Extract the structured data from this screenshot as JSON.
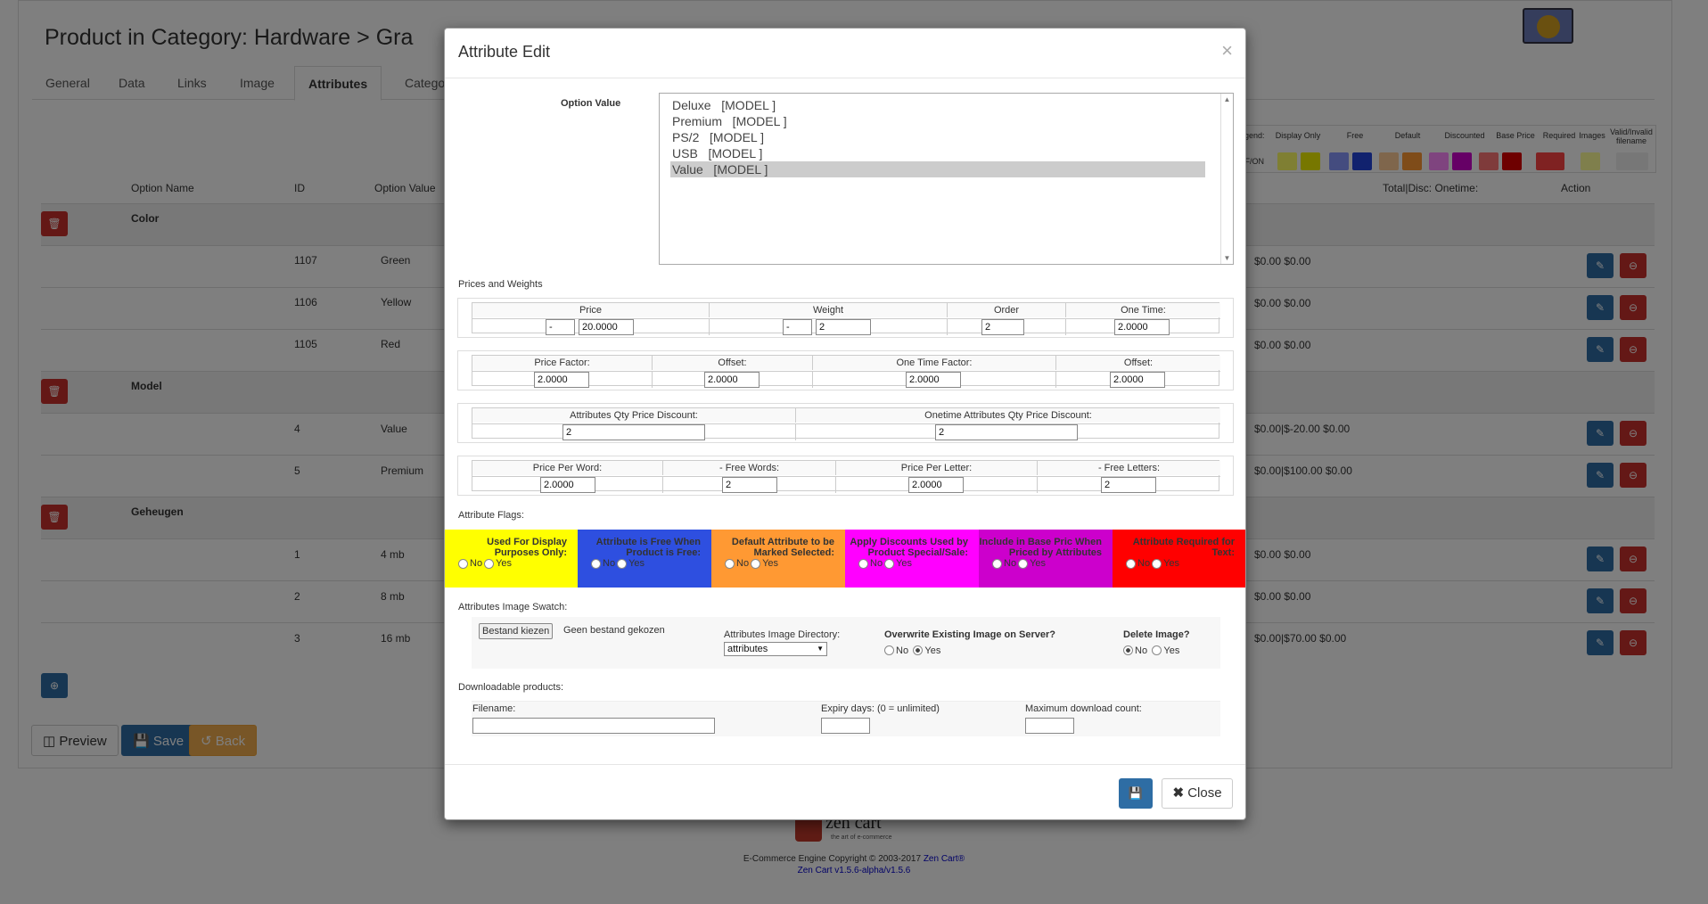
{
  "page": {
    "title": "Product in Category: Hardware > Gra",
    "tabs": [
      "General",
      "Data",
      "Links",
      "Image",
      "Attributes",
      "Catego"
    ],
    "legend": {
      "headers": [
        "egend:",
        "Display Only",
        "Free",
        "Default",
        "Discounted",
        "Base Price",
        "Required",
        "Images",
        "Valid/Invalid filename"
      ],
      "offon": "FF/ON"
    },
    "table_headers": {
      "option_name": "Option Name",
      "id": "ID",
      "option_value": "Option Value",
      "total_disc": "Total|Disc: Onetime:",
      "action": "Action"
    },
    "groups": [
      {
        "name": "Color",
        "rows": [
          {
            "id": "1107",
            "value": "Green",
            "prices": "$0.00 $0.00"
          },
          {
            "id": "1106",
            "value": "Yellow",
            "prices": "$0.00 $0.00"
          },
          {
            "id": "1105",
            "value": "Red",
            "prices": "$0.00 $0.00"
          }
        ]
      },
      {
        "name": "Model",
        "rows": [
          {
            "id": "4",
            "value": "Value",
            "prices": "$0.00|$-20.00 $0.00"
          },
          {
            "id": "5",
            "value": "Premium",
            "prices": "$0.00|$100.00 $0.00"
          }
        ]
      },
      {
        "name": "Geheugen",
        "rows": [
          {
            "id": "1",
            "value": "4 mb",
            "prices": "$0.00 $0.00"
          },
          {
            "id": "2",
            "value": "8 mb",
            "prices": "$0.00 $0.00"
          },
          {
            "id": "3",
            "value": "16 mb",
            "prices": "$0.00|$70.00 $0.00"
          }
        ]
      }
    ],
    "buttons": {
      "preview": "Preview",
      "save": "Save",
      "back": "Back"
    },
    "footer": {
      "logo_text": "zen cart",
      "logo_sub": "the art of e-commerce",
      "copyright": "E-Commerce Engine Copyright © 2003-2017 ",
      "zen_link": "Zen Cart®",
      "version": "Zen Cart v1.5.6-alpha/v1.5.6"
    }
  },
  "modal": {
    "title": "Attribute Edit",
    "close_x": "×",
    "option_value_label": "Option Value",
    "options": [
      "Deluxe   [MODEL ]",
      "Premium   [MODEL ]",
      "PS/2   [MODEL ]",
      "USB   [MODEL ]",
      "Value   [MODEL ]"
    ],
    "selected_option": "Value   [MODEL ]",
    "prices_weights_label": "Prices and Weights",
    "price_row": {
      "headers": [
        "Price",
        "Weight",
        "Order",
        "One Time:"
      ],
      "price_prefix": "-",
      "price": "20.0000",
      "weight_prefix": "-",
      "weight": "2",
      "order": "2",
      "one_time": "2.0000"
    },
    "factor_row": {
      "headers": [
        "Price Factor:",
        "Offset:",
        "One Time Factor:",
        "Offset:"
      ],
      "values": [
        "2.0000",
        "2.0000",
        "2.0000",
        "2.0000"
      ]
    },
    "qty_row": {
      "headers": [
        "Attributes Qty Price Discount:",
        "Onetime Attributes Qty Price Discount:"
      ],
      "values": [
        "2",
        "2"
      ]
    },
    "word_row": {
      "headers": [
        "Price Per Word:",
        "- Free Words:",
        "Price Per Letter:",
        "- Free Letters:"
      ],
      "values": [
        "2.0000",
        "2",
        "2.0000",
        "2"
      ]
    },
    "flags_label": "Attribute Flags:",
    "flags": [
      {
        "label": "Used For Display Purposes Only:",
        "color": "#ffff00"
      },
      {
        "label": "Attribute is Free When Product is Free:",
        "color": "#2e4fe0"
      },
      {
        "label": "Default Attribute to be Marked Selected:",
        "color": "#ff9933"
      },
      {
        "label": "Apply Discounts Used by Product Special/Sale:",
        "color": "#ff00ff"
      },
      {
        "label": "Include in Base Pric When Priced by Attributes",
        "color": "#cc00cc"
      },
      {
        "label": "Attribute Required for Text:",
        "color": "#ff0000"
      }
    ],
    "no": "No",
    "yes": "Yes",
    "swatch_label": "Attributes Image Swatch:",
    "file_button": "Bestand kiezen",
    "no_file": "Geen bestand gekozen",
    "image_dir_label": "Attributes Image Directory:",
    "image_dir_value": "attributes",
    "overwrite_label": "Overwrite Existing Image on Server?",
    "delete_label": "Delete Image?",
    "downloads_label": "Downloadable products:",
    "filename_label": "Filename:",
    "expiry_label": "Expiry days: (0 = unlimited)",
    "max_label": "Maximum download count:",
    "close_button": "Close"
  }
}
